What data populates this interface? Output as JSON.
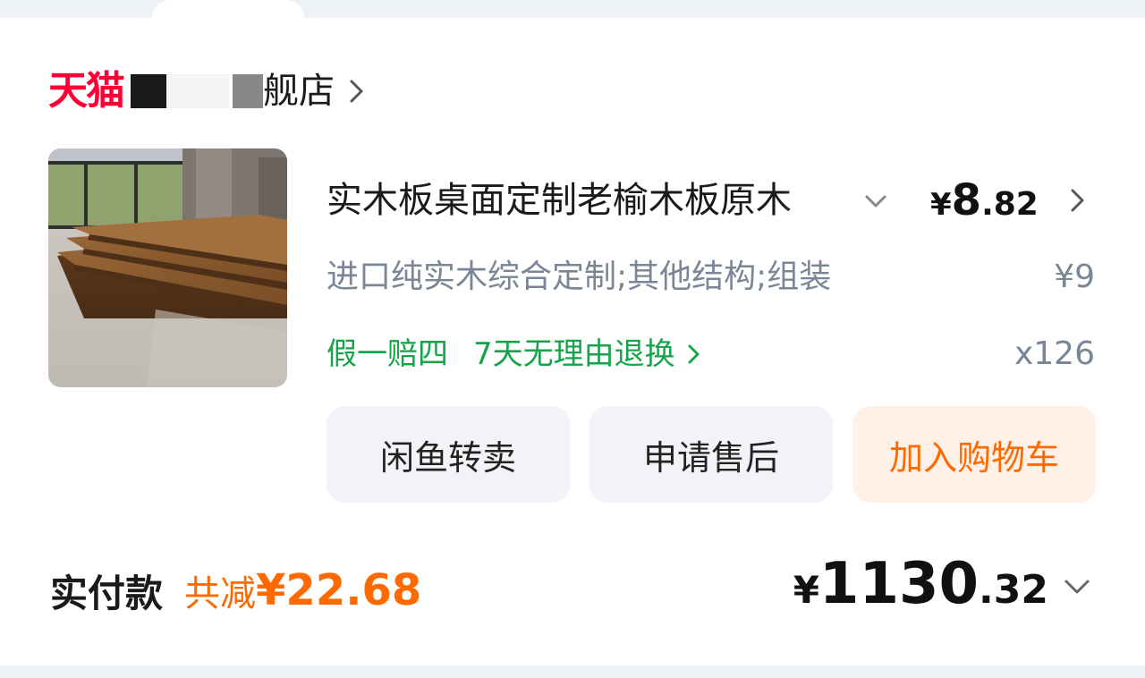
{
  "store": {
    "platform_logo": "天猫",
    "name_suffix": "舰店",
    "chevron_icon": "chevron-right-icon"
  },
  "product": {
    "title": "实木板桌面定制老榆木板原木",
    "title_toggle_icon": "chevron-down-icon",
    "price_symbol": "¥",
    "price_integer": "8",
    "price_decimal": ".82",
    "spec": "进口纯实木综合定制;其他结构;组装",
    "original_price": "¥9",
    "quantity": "x126",
    "guarantee": "假一赔四",
    "return_policy": "7天无理由退换"
  },
  "actions": {
    "resell": "闲鱼转卖",
    "after_sale": "申请售后",
    "add_to_cart": "加入购物车"
  },
  "summary": {
    "paid_label": "实付款",
    "discount_label": "共减",
    "discount_amount": "¥22.68",
    "total_symbol": "¥",
    "total_integer": "1130",
    "total_decimal": ".32"
  },
  "colors": {
    "tmall_red": "#ff0036",
    "accent_orange": "#ff6a00",
    "guarantee_green": "#17a34a",
    "muted_text": "#7a8696"
  }
}
